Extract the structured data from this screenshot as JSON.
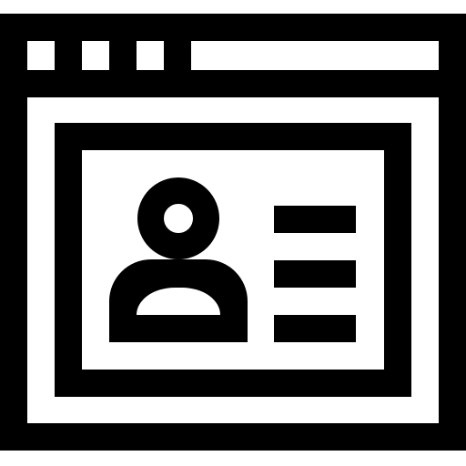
{
  "icon": {
    "name": "browser-profile-card-icon",
    "foreground_color": "#000000",
    "background_color": "#ffffff",
    "window_control_dots": 3,
    "detail_lines": 3
  }
}
